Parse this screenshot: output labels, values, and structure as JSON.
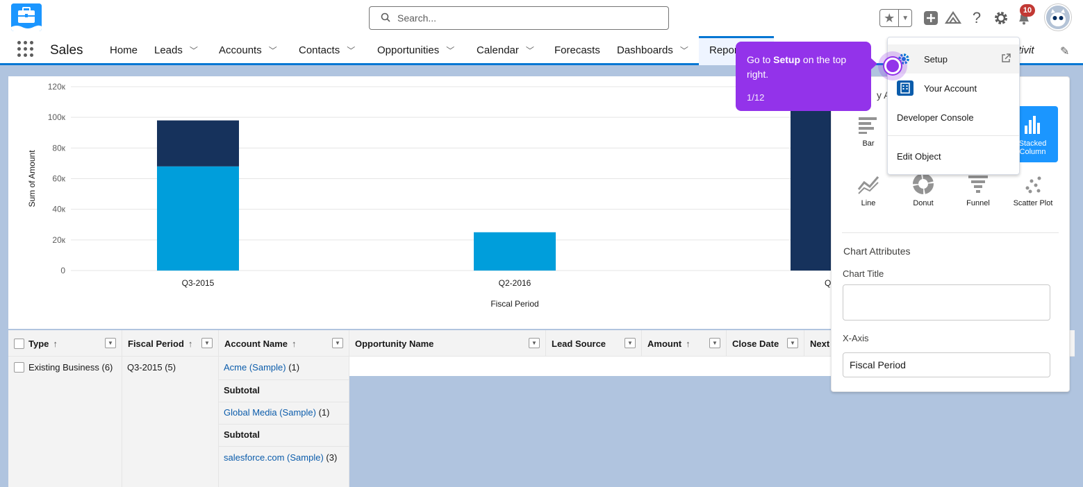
{
  "header": {
    "search_placeholder": "Search...",
    "notification_count": "10"
  },
  "nav": {
    "app_name": "Sales",
    "items": [
      {
        "label": "Home",
        "chevron": false
      },
      {
        "label": "Leads",
        "chevron": true
      },
      {
        "label": "Accounts",
        "chevron": true
      },
      {
        "label": "Contacts",
        "chevron": true
      },
      {
        "label": "Opportunities",
        "chevron": true
      },
      {
        "label": "Calendar",
        "chevron": true
      },
      {
        "label": "Forecasts",
        "chevron": false
      },
      {
        "label": "Dashboards",
        "chevron": true
      },
      {
        "label": "Repor",
        "chevron": false
      }
    ]
  },
  "chart_data": {
    "type": "bar",
    "stacked": true,
    "categories": [
      "Q3-2015",
      "Q2-2016",
      "Q1-"
    ],
    "series": [
      {
        "color": "#009edb",
        "values": [
          68000,
          25000,
          0
        ]
      },
      {
        "color": "#16325c",
        "values": [
          30000,
          0,
          110000
        ]
      }
    ],
    "xlabel": "Fiscal Period",
    "ylabel": "Sum of Amount",
    "yticks": [
      "0",
      "20к",
      "40к",
      "60к",
      "80к",
      "100к",
      "120к"
    ],
    "ylim": [
      0,
      120000
    ],
    "grid": true
  },
  "table": {
    "columns": [
      {
        "label": "Type",
        "arrow": "↑"
      },
      {
        "label": "Fiscal Period",
        "arrow": "↑"
      },
      {
        "label": "Account Name",
        "arrow": "↑"
      },
      {
        "label": "Opportunity Name",
        "arrow": ""
      },
      {
        "label": "Lead Source",
        "arrow": ""
      },
      {
        "label": "Amount",
        "arrow": "↑"
      },
      {
        "label": "Close Date",
        "arrow": ""
      },
      {
        "label": "Next",
        "arrow": ""
      }
    ],
    "type_value": "Existing Business (6)",
    "fiscal_value": "Q3-2015 (5)",
    "rows": [
      {
        "name": "Acme (Sample)",
        "count": "(1)"
      },
      {
        "subtotal": "Subtotal"
      },
      {
        "name": "Global Media (Sample)",
        "count": "(1)"
      },
      {
        "subtotal": "Subtotal"
      },
      {
        "name": "salesforce.com (Sample)",
        "count": "(3)"
      }
    ]
  },
  "config": {
    "partial_heading": "y As",
    "chart_types": [
      {
        "label": "Bar",
        "icon": "bar-chart-icon"
      },
      {
        "label": "Stacked Column",
        "icon": "stacked-column-icon",
        "selected": true
      },
      {
        "label": "Line",
        "icon": "line-chart-icon"
      },
      {
        "label": "Donut",
        "icon": "donut-chart-icon"
      },
      {
        "label": "Funnel",
        "icon": "funnel-chart-icon"
      },
      {
        "label": "Scatter Plot",
        "icon": "scatter-plot-icon"
      }
    ],
    "stacked_line1": "Stacked",
    "stacked_line2": "Column",
    "attributes_heading": "Chart Attributes",
    "chart_title_label": "Chart Title",
    "chart_title_value": "",
    "xaxis_label": "X-Axis",
    "xaxis_value": "Fiscal Period"
  },
  "menu": {
    "items": [
      "Setup",
      "Your Account",
      "Developer Console",
      "Edit Object"
    ]
  },
  "tooltip": {
    "text_before": "Go to ",
    "text_bold": "Setup",
    "text_after": " on the top right.",
    "step": "1/12"
  },
  "partial_tab": "tivit"
}
